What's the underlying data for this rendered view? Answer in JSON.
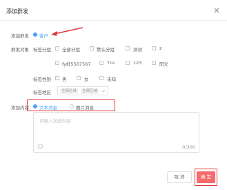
{
  "dialog": {
    "title": "添加群发",
    "close_icon": "close-icon"
  },
  "form": {
    "send_to_label": "添加群发",
    "send_to_option": "客户",
    "target_label": "群发对象",
    "target_prefix": "标签分组",
    "target_options": [
      "全部分组",
      "默认分组",
      "测试",
      "z",
      "fy好5567567",
      "7cs",
      "123",
      "阳光"
    ],
    "gender_label": "标签性别",
    "gender_options": [
      "男",
      "女",
      "未知"
    ],
    "area_label": "标签地区",
    "area_tags": [
      "全部区域",
      "全部区域"
    ],
    "content_label": "添加内容",
    "content_options": [
      "文本消息",
      "图片消息"
    ],
    "content_placeholder": "请输入发送内容",
    "counter": "0/300"
  },
  "footer": {
    "cancel_label": "取 消",
    "ok_label": "确 定"
  },
  "colors": {
    "accent": "#409eff",
    "danger": "#f56c6c",
    "annotation": "#e03535"
  }
}
